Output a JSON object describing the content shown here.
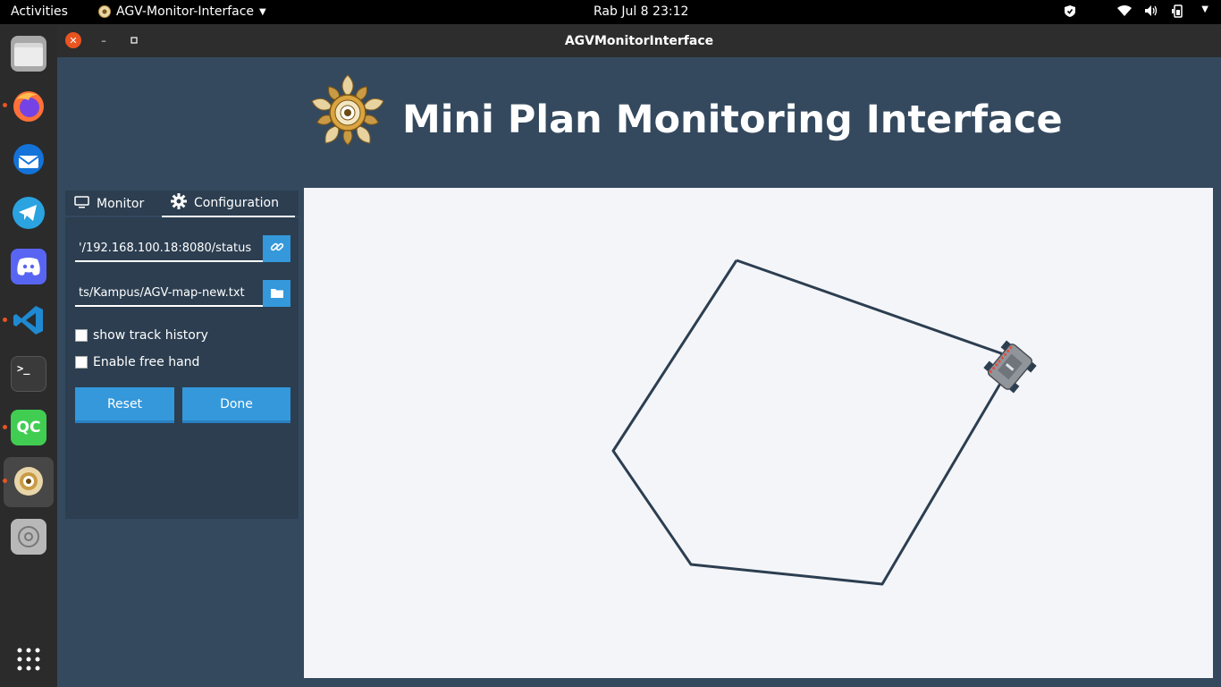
{
  "topbar": {
    "activities": "Activities",
    "app_name": "AGV-Monitor-Interface",
    "clock": "Rab Jul 8  23:12"
  },
  "dock": {
    "items": [
      "files-icon",
      "firefox-icon",
      "thunderbird-icon",
      "telegram-icon",
      "discord-icon",
      "vscode-icon",
      "terminal-icon",
      "qtcreator-icon",
      "agv-monitor-icon",
      "disc-icon",
      "app-grid-icon"
    ],
    "qt_label": "QC",
    "terminal_label": ">_"
  },
  "window": {
    "title": "AGVMonitorInterface",
    "header_title": "Mini Plan Monitoring Interface"
  },
  "panel": {
    "tabs": [
      {
        "label": "Monitor",
        "active": false
      },
      {
        "label": "Configuration",
        "active": true
      }
    ],
    "url_value": "'/192.168.100.18:8080/status",
    "map_file_value": "ts/Kampus/AGV-map-new.txt",
    "show_track_history_label": "show track history",
    "show_track_history_checked": false,
    "free_hand_label": "Enable free hand",
    "free_hand_checked": false,
    "reset_label": "Reset",
    "done_label": "Done"
  },
  "colors": {
    "accent": "#3498db",
    "window_bg": "#34495e",
    "panel_bg": "#2c3e50",
    "map_bg": "#f4f5f9",
    "path_line": "#2c3e50",
    "ubuntu_orange": "#e95420"
  }
}
